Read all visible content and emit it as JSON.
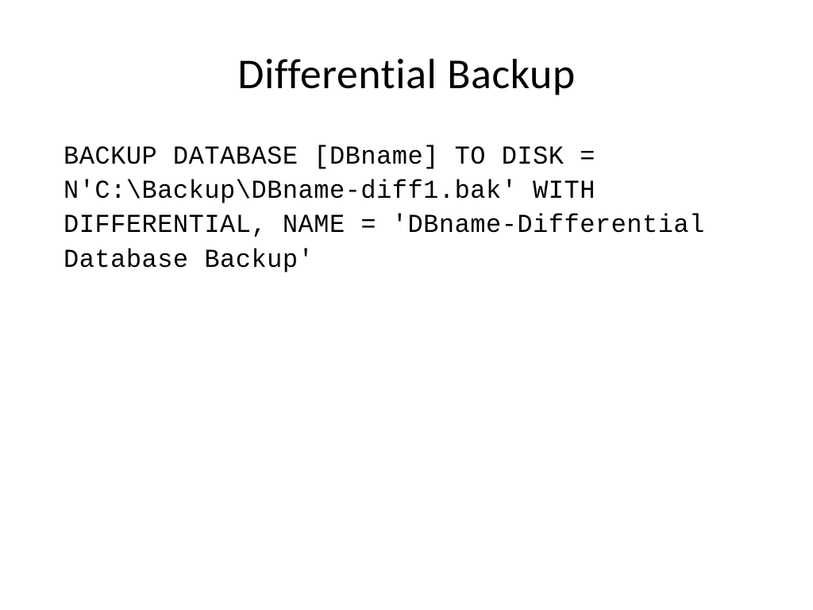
{
  "slide": {
    "title": "Differential Backup",
    "code": "BACKUP DATABASE [DBname] TO DISK = N'C:\\Backup\\DBname-diff1.bak' WITH DIFFERENTIAL, NAME = 'DBname-Differential Database Backup'"
  }
}
